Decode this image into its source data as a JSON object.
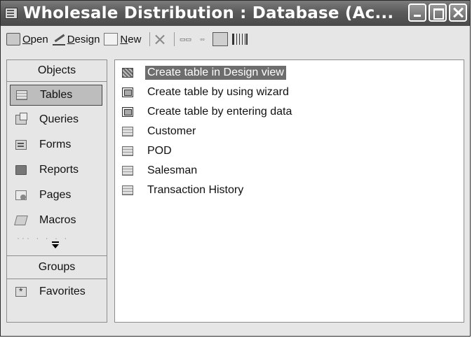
{
  "window": {
    "title": "Wholesale Distribution : Database (Ac..."
  },
  "toolbar": {
    "open_label_u": "O",
    "open_label_rest": "pen",
    "design_label_u": "D",
    "design_label_rest": "esign",
    "new_label_u": "N",
    "new_label_rest": "ew",
    "icons": [
      "open-icon",
      "design-icon",
      "new-icon",
      "delete-icon",
      "large-icons-icon",
      "small-icons-icon",
      "list-icon",
      "details-icon"
    ]
  },
  "sidebar": {
    "objects_header": "Objects",
    "items": [
      {
        "label": "Tables",
        "icon": "table-icon",
        "selected": true
      },
      {
        "label": "Queries",
        "icon": "query-icon"
      },
      {
        "label": "Forms",
        "icon": "form-icon"
      },
      {
        "label": "Reports",
        "icon": "report-icon"
      },
      {
        "label": "Pages",
        "icon": "page-icon"
      },
      {
        "label": "Macros",
        "icon": "macro-icon"
      }
    ],
    "groups_header": "Groups",
    "groups": [
      {
        "label": "Favorites",
        "icon": "favorites-icon"
      }
    ]
  },
  "list": {
    "items": [
      {
        "label": "Create table in Design view",
        "icon": "design-view-icon",
        "highlighted": true
      },
      {
        "label": "Create table by using wizard",
        "icon": "wizard-icon"
      },
      {
        "label": "Create table by entering data",
        "icon": "wizard-icon"
      },
      {
        "label": "Customer",
        "icon": "table-icon"
      },
      {
        "label": "POD",
        "icon": "table-icon"
      },
      {
        "label": "Salesman",
        "icon": "table-icon"
      },
      {
        "label": "Transaction History",
        "icon": "table-icon"
      }
    ]
  },
  "colors": {
    "titlebar": "#5a5a5a",
    "selection": "#6d6d6d",
    "panel": "#e6e6e6"
  }
}
